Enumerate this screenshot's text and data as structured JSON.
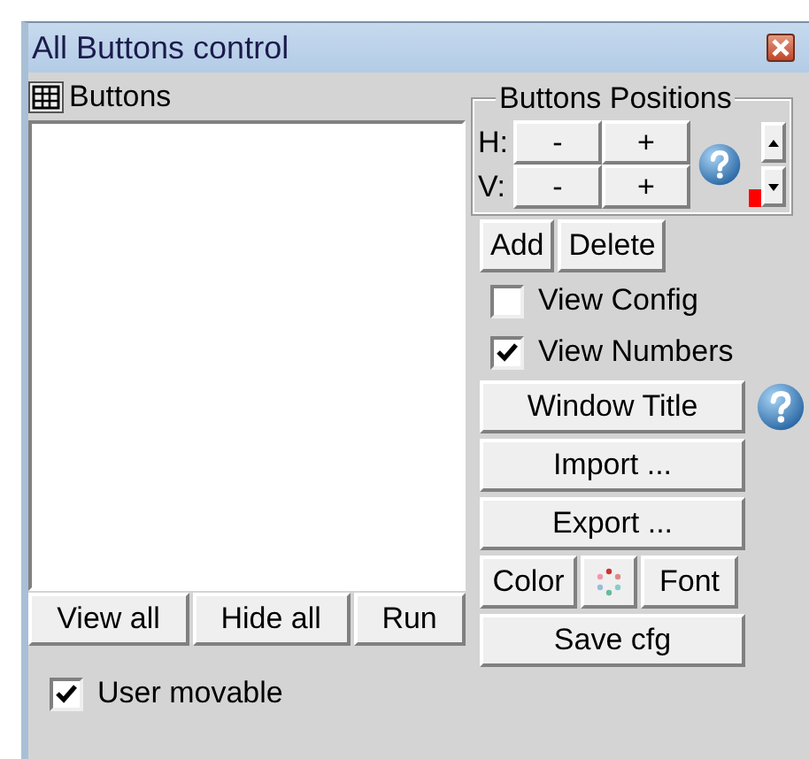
{
  "window": {
    "title": "All Buttons control"
  },
  "list": {
    "label": "Buttons",
    "buttons": [
      "View all",
      "Hide all",
      "Run"
    ]
  },
  "user_movable": {
    "label": "User movable",
    "checked": true
  },
  "positions": {
    "title": "Buttons Positions",
    "rows": [
      {
        "label": "H:",
        "minus": "-",
        "plus": "+"
      },
      {
        "label": "V:",
        "minus": "-",
        "plus": "+"
      }
    ]
  },
  "edit_buttons": [
    "Add",
    "Delete"
  ],
  "options": [
    {
      "label": "View Config",
      "checked": false
    },
    {
      "label": "View Numbers",
      "checked": true
    }
  ],
  "window_title_button": "Window Title",
  "file_buttons": [
    "Import ...",
    "Export ..."
  ],
  "style_buttons": [
    "Color",
    "Font"
  ],
  "save_button": "Save cfg"
}
